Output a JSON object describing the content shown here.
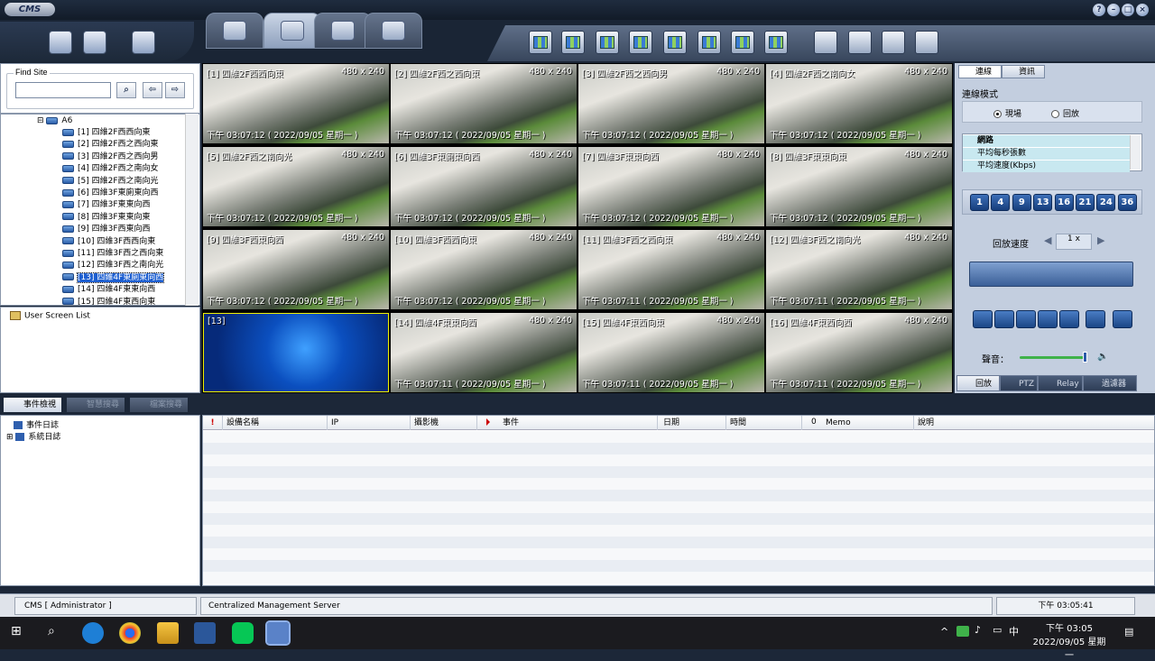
{
  "app": {
    "logo": "CMS"
  },
  "window_controls": [
    "?",
    "–",
    "□",
    "×"
  ],
  "find_site": {
    "legend": "Find Site",
    "placeholder": "",
    "search_icon": "search-icon",
    "prev_icon": "arrow-left-icon",
    "next_icon": "arrow-right-icon"
  },
  "tree": {
    "root": "A6",
    "items": [
      "[1] 四維2F西西向東",
      "[2] 四維2F西之西向東",
      "[3] 四維2F西之西向男",
      "[4] 四維2F西之南向女",
      "[5] 四維2F西之南向光",
      "[6] 四維3F東廁東向西",
      "[7] 四維3F東東向西",
      "[8] 四維3F東東向東",
      "[9] 四維3F西東向西",
      "[10] 四維3F西西向東",
      "[11] 四維3F西之西向東",
      "[12] 四維3F西之南向光",
      "[13] 四維4F東廁東向西",
      "[14] 四維4F東東向西",
      "[15] 四維4F東西向東"
    ],
    "selected": 12
  },
  "user_screen_list": "User Screen List",
  "cameras": [
    {
      "label": "[1] 四維2F西西向東",
      "res": "480 x 240",
      "ts": "下午 03:07:12 ( 2022/09/05 星期一 )"
    },
    {
      "label": "[2] 四維2F西之西向東",
      "res": "480 x 240",
      "ts": "下午 03:07:12 ( 2022/09/05 星期一 )"
    },
    {
      "label": "[3] 四維2F西之西向男",
      "res": "480 x 240",
      "ts": "下午 03:07:12 ( 2022/09/05 星期一 )"
    },
    {
      "label": "[4] 四維2F西之南向女",
      "res": "480 x 240",
      "ts": "下午 03:07:12 ( 2022/09/05 星期一 )"
    },
    {
      "label": "[5] 四維2F西之南向光",
      "res": "480 x 240",
      "ts": "下午 03:07:12 ( 2022/09/05 星期一 )"
    },
    {
      "label": "[6] 四維3F東廁東向西",
      "res": "480 x 240",
      "ts": "下午 03:07:12 ( 2022/09/05 星期一 )"
    },
    {
      "label": "[7] 四維3F東東向西",
      "res": "480 x 240",
      "ts": "下午 03:07:12 ( 2022/09/05 星期一 )"
    },
    {
      "label": "[8] 四維3F東東向東",
      "res": "480 x 240",
      "ts": "下午 03:07:12 ( 2022/09/05 星期一 )"
    },
    {
      "label": "[9] 四維3F西東向西",
      "res": "480 x 240",
      "ts": "下午 03:07:12 ( 2022/09/05 星期一 )"
    },
    {
      "label": "[10] 四維3F西西向東",
      "res": "480 x 240",
      "ts": "下午 03:07:12 ( 2022/09/05 星期一 )"
    },
    {
      "label": "[11] 四維3F西之西向東",
      "res": "480 x 240",
      "ts": "下午 03:07:11 ( 2022/09/05 星期一 )"
    },
    {
      "label": "[12] 四維3F西之南向光",
      "res": "480 x 240",
      "ts": "下午 03:07:11 ( 2022/09/05 星期一 )"
    },
    {
      "label": "[13]",
      "res": "",
      "ts": ""
    },
    {
      "label": "[14] 四維4F東東向西",
      "res": "480 x 240",
      "ts": "下午 03:07:11 ( 2022/09/05 星期一 )"
    },
    {
      "label": "[15] 四維4F東西向東",
      "res": "480 x 240",
      "ts": "下午 03:07:11 ( 2022/09/05 星期一 )"
    },
    {
      "label": "[16] 四維4F東西向西",
      "res": "480 x 240",
      "ts": "下午 03:07:11 ( 2022/09/05 星期一 )"
    }
  ],
  "right_panel": {
    "tabs": [
      "連線",
      "資訊"
    ],
    "conn_mode_label": "連線模式",
    "radio_live": "現場",
    "radio_playback": "回放",
    "net_items": [
      "網路",
      "平均每秒張數",
      "平均速度(Kbps)"
    ],
    "split_buttons": [
      "1",
      "4",
      "9",
      "13",
      "16",
      "21",
      "24",
      "36"
    ],
    "speed_label": "回放速度",
    "speed_value": "1 x",
    "volume_label": "聲音：",
    "bottom_tabs": [
      "回放",
      "PTZ",
      "Relay",
      "過濾器"
    ]
  },
  "event_tabs": [
    "事件檢視",
    "智慧搜尋",
    "檔案搜尋"
  ],
  "log_tree": [
    "事件日誌",
    "系統日誌"
  ],
  "table_headers": [
    "設備名稱",
    "IP",
    "攝影機",
    "事件",
    "日期",
    "時間",
    "Memo",
    "說明"
  ],
  "status": {
    "left": "CMS [ Administrator ]",
    "center": "Centralized Management Server",
    "right": "下午 03:05:41"
  },
  "taskbar": {
    "time": "下午 03:05",
    "date": "2022/09/05 星期一",
    "ime": "中"
  }
}
